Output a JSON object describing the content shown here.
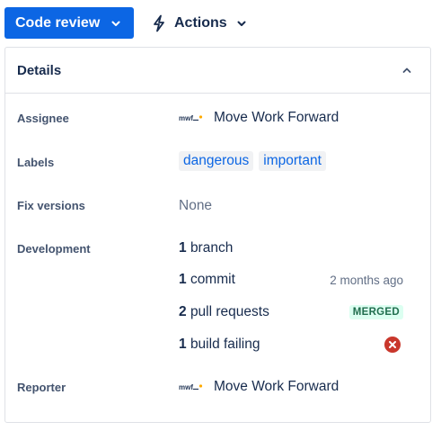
{
  "toolbar": {
    "status_label": "Code review",
    "actions_label": "Actions"
  },
  "details": {
    "title": "Details",
    "assignee": {
      "label": "Assignee",
      "logo_text": "mwf",
      "name": "Move Work Forward"
    },
    "labels": {
      "label": "Labels",
      "items": [
        "dangerous",
        "important"
      ]
    },
    "fix_versions": {
      "label": "Fix versions",
      "value": "None"
    },
    "development": {
      "label": "Development",
      "branch": {
        "count": "1",
        "text": "branch"
      },
      "commit": {
        "count": "1",
        "text": "commit",
        "meta": "2 months ago"
      },
      "pull_requests": {
        "count": "2",
        "text": "pull requests",
        "status": "MERGED"
      },
      "build": {
        "count": "1",
        "text": "build failing"
      }
    },
    "reporter": {
      "label": "Reporter",
      "logo_text": "mwf",
      "name": "Move Work Forward"
    }
  },
  "colors": {
    "primary": "#0c66e4",
    "merged_bg": "#dcfff1",
    "merged_text": "#216e4e",
    "error": "#c9372c"
  }
}
